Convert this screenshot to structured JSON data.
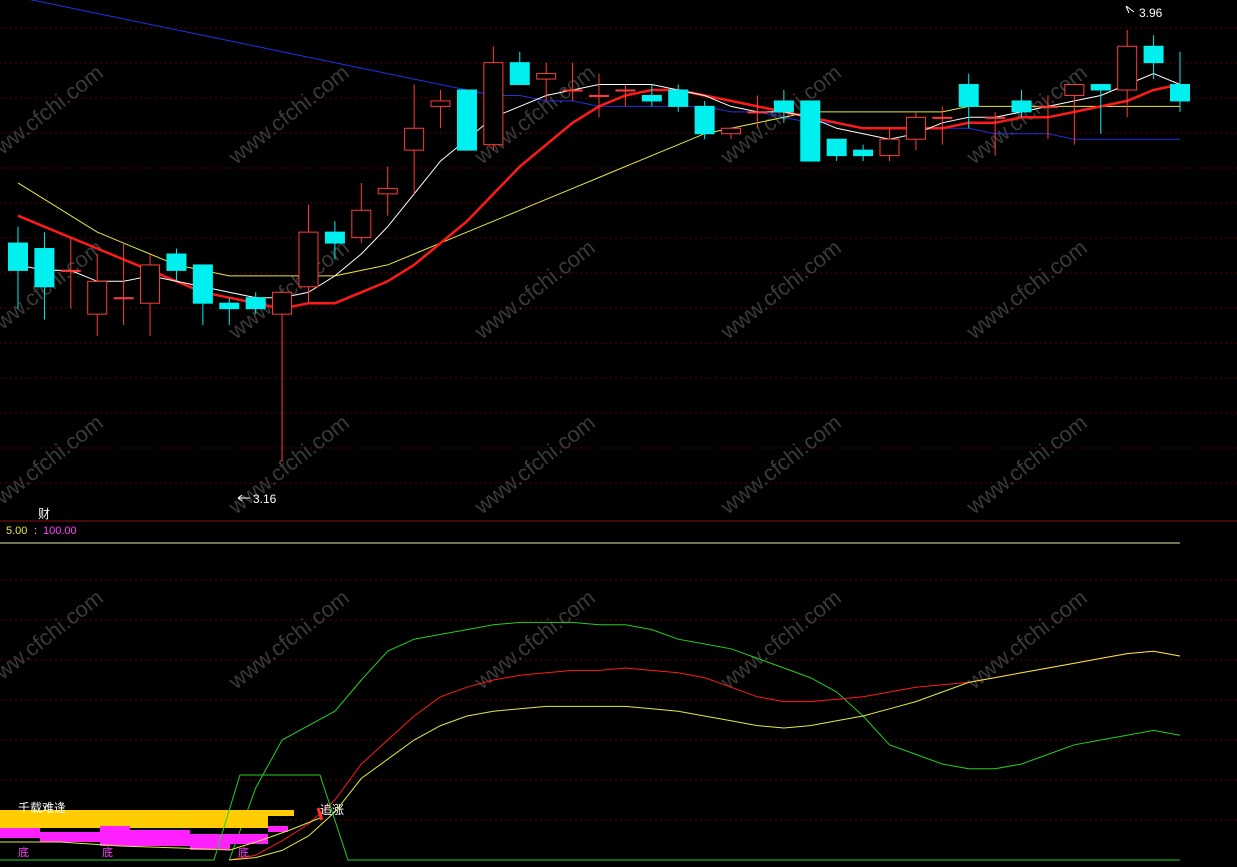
{
  "main_panel": {
    "high_label": "3.96",
    "low_label": "3.16",
    "bottom_tag": "财"
  },
  "indicator_panel": {
    "param_first": "5.00",
    "param_sep": ":",
    "param_second": "100.00",
    "text_left": "千载难逢",
    "text_mid": "追涨",
    "marker_1": "底",
    "marker_2": "底",
    "marker_3": "底"
  },
  "watermark": "www.cfchi.com",
  "colors": {
    "up": "#ff3b3b",
    "down": "#00f0f0",
    "ma_white": "#ffffff",
    "ma_red": "#ff1a1a",
    "ma_yellow": "#e8e840",
    "ma_blue": "#2030e0",
    "grid": "#5a0000",
    "green": "#20d020",
    "magenta": "#ff20ff",
    "gold": "#ffcc00"
  },
  "chart_data": [
    {
      "type": "candlestick",
      "y_range": [
        3.1,
        4.0
      ],
      "candles": [
        {
          "o": 3.57,
          "h": 3.6,
          "l": 3.45,
          "c": 3.52
        },
        {
          "o": 3.56,
          "h": 3.59,
          "l": 3.43,
          "c": 3.49
        },
        {
          "o": 3.52,
          "h": 3.58,
          "l": 3.45,
          "c": 3.52
        },
        {
          "o": 3.44,
          "h": 3.55,
          "l": 3.4,
          "c": 3.5
        },
        {
          "o": 3.47,
          "h": 3.57,
          "l": 3.42,
          "c": 3.47
        },
        {
          "o": 3.46,
          "h": 3.55,
          "l": 3.4,
          "c": 3.53
        },
        {
          "o": 3.55,
          "h": 3.56,
          "l": 3.5,
          "c": 3.52
        },
        {
          "o": 3.53,
          "h": 3.53,
          "l": 3.42,
          "c": 3.46
        },
        {
          "o": 3.46,
          "h": 3.47,
          "l": 3.42,
          "c": 3.45
        },
        {
          "o": 3.47,
          "h": 3.48,
          "l": 3.44,
          "c": 3.45
        },
        {
          "o": 3.44,
          "h": 3.46,
          "l": 3.17,
          "c": 3.48
        },
        {
          "o": 3.49,
          "h": 3.64,
          "l": 3.46,
          "c": 3.59
        },
        {
          "o": 3.59,
          "h": 3.61,
          "l": 3.54,
          "c": 3.57
        },
        {
          "o": 3.58,
          "h": 3.68,
          "l": 3.57,
          "c": 3.63
        },
        {
          "o": 3.66,
          "h": 3.71,
          "l": 3.62,
          "c": 3.67
        },
        {
          "o": 3.74,
          "h": 3.86,
          "l": 3.66,
          "c": 3.78
        },
        {
          "o": 3.82,
          "h": 3.85,
          "l": 3.78,
          "c": 3.83
        },
        {
          "o": 3.85,
          "h": 3.85,
          "l": 3.74,
          "c": 3.74
        },
        {
          "o": 3.75,
          "h": 3.93,
          "l": 3.74,
          "c": 3.9
        },
        {
          "o": 3.9,
          "h": 3.92,
          "l": 3.86,
          "c": 3.86
        },
        {
          "o": 3.87,
          "h": 3.9,
          "l": 3.83,
          "c": 3.88
        },
        {
          "o": 3.85,
          "h": 3.9,
          "l": 3.83,
          "c": 3.85
        },
        {
          "o": 3.84,
          "h": 3.88,
          "l": 3.8,
          "c": 3.84
        },
        {
          "o": 3.85,
          "h": 3.86,
          "l": 3.82,
          "c": 3.85
        },
        {
          "o": 3.84,
          "h": 3.86,
          "l": 3.82,
          "c": 3.83
        },
        {
          "o": 3.85,
          "h": 3.86,
          "l": 3.81,
          "c": 3.82
        },
        {
          "o": 3.82,
          "h": 3.83,
          "l": 3.76,
          "c": 3.77
        },
        {
          "o": 3.77,
          "h": 3.78,
          "l": 3.76,
          "c": 3.78
        },
        {
          "o": 3.81,
          "h": 3.84,
          "l": 3.78,
          "c": 3.81
        },
        {
          "o": 3.83,
          "h": 3.85,
          "l": 3.79,
          "c": 3.81
        },
        {
          "o": 3.83,
          "h": 3.83,
          "l": 3.76,
          "c": 3.72
        },
        {
          "o": 3.76,
          "h": 3.76,
          "l": 3.72,
          "c": 3.73
        },
        {
          "o": 3.74,
          "h": 3.75,
          "l": 3.72,
          "c": 3.73
        },
        {
          "o": 3.73,
          "h": 3.78,
          "l": 3.72,
          "c": 3.76
        },
        {
          "o": 3.76,
          "h": 3.81,
          "l": 3.74,
          "c": 3.8
        },
        {
          "o": 3.8,
          "h": 3.82,
          "l": 3.75,
          "c": 3.8
        },
        {
          "o": 3.86,
          "h": 3.88,
          "l": 3.78,
          "c": 3.82
        },
        {
          "o": 3.8,
          "h": 3.81,
          "l": 3.73,
          "c": 3.8
        },
        {
          "o": 3.83,
          "h": 3.85,
          "l": 3.8,
          "c": 3.81
        },
        {
          "o": 3.82,
          "h": 3.84,
          "l": 3.76,
          "c": 3.82
        },
        {
          "o": 3.84,
          "h": 3.86,
          "l": 3.75,
          "c": 3.86
        },
        {
          "o": 3.86,
          "h": 3.86,
          "l": 3.77,
          "c": 3.85
        },
        {
          "o": 3.85,
          "h": 3.96,
          "l": 3.8,
          "c": 3.93
        },
        {
          "o": 3.93,
          "h": 3.95,
          "l": 3.87,
          "c": 3.9
        },
        {
          "o": 3.86,
          "h": 3.92,
          "l": 3.81,
          "c": 3.83
        }
      ],
      "ma_white": [
        3.53,
        3.52,
        3.52,
        3.5,
        3.5,
        3.51,
        3.5,
        3.49,
        3.48,
        3.47,
        3.47,
        3.48,
        3.51,
        3.55,
        3.6,
        3.66,
        3.72,
        3.76,
        3.8,
        3.82,
        3.84,
        3.85,
        3.86,
        3.86,
        3.86,
        3.85,
        3.84,
        3.82,
        3.81,
        3.81,
        3.8,
        3.78,
        3.77,
        3.76,
        3.77,
        3.79,
        3.8,
        3.8,
        3.81,
        3.82,
        3.83,
        3.84,
        3.86,
        3.88,
        3.86
      ],
      "ma_red": [
        3.62,
        3.6,
        3.58,
        3.56,
        3.54,
        3.52,
        3.5,
        3.48,
        3.47,
        3.46,
        3.45,
        3.46,
        3.46,
        3.48,
        3.5,
        3.53,
        3.57,
        3.61,
        3.66,
        3.71,
        3.75,
        3.79,
        3.82,
        3.84,
        3.85,
        3.85,
        3.84,
        3.83,
        3.82,
        3.81,
        3.8,
        3.79,
        3.78,
        3.78,
        3.78,
        3.78,
        3.79,
        3.79,
        3.8,
        3.8,
        3.81,
        3.82,
        3.83,
        3.85,
        3.86
      ],
      "ma_yellow": [
        3.68,
        3.65,
        3.62,
        3.59,
        3.57,
        3.55,
        3.53,
        3.52,
        3.51,
        3.51,
        3.51,
        3.51,
        3.51,
        3.52,
        3.53,
        3.55,
        3.57,
        3.59,
        3.61,
        3.63,
        3.65,
        3.67,
        3.69,
        3.71,
        3.73,
        3.75,
        3.77,
        3.78,
        3.79,
        3.8,
        3.81,
        3.81,
        3.81,
        3.81,
        3.81,
        3.81,
        3.82,
        3.82,
        3.82,
        3.82,
        3.82,
        3.82,
        3.82,
        3.82,
        3.82
      ],
      "ma_blue": [
        4.02,
        4.01,
        4.0,
        3.99,
        3.98,
        3.97,
        3.96,
        3.95,
        3.94,
        3.93,
        3.92,
        3.91,
        3.9,
        3.89,
        3.88,
        3.87,
        3.86,
        3.85,
        3.84,
        3.84,
        3.83,
        3.83,
        3.82,
        3.82,
        3.82,
        3.82,
        3.82,
        3.81,
        3.81,
        3.8,
        3.79,
        3.79,
        3.78,
        3.78,
        3.78,
        3.78,
        3.78,
        3.77,
        3.77,
        3.77,
        3.76,
        3.76,
        3.76,
        3.76,
        3.76
      ]
    },
    {
      "type": "line",
      "y_range": [
        0,
        100
      ],
      "series": [
        {
          "values": [
            0,
            0,
            0,
            0,
            0,
            0,
            0,
            0,
            0,
            30,
            50,
            56,
            62,
            75,
            87,
            92,
            94,
            96,
            98,
            99,
            99,
            99,
            98,
            98,
            96,
            92,
            90,
            88,
            84,
            80,
            76,
            70,
            60,
            48,
            44,
            40,
            38,
            38,
            40,
            44,
            48,
            50,
            52,
            54,
            52
          ]
        },
        {
          "values": [
            0,
            0,
            0,
            0,
            0,
            0,
            0,
            0,
            0,
            2,
            8,
            15,
            25,
            40,
            50,
            60,
            68,
            72,
            75,
            77,
            78,
            79,
            79,
            80,
            79,
            78,
            76,
            72,
            68,
            66,
            66,
            67,
            68,
            70,
            72,
            73,
            74,
            76,
            78,
            80,
            82,
            84,
            86,
            87,
            85
          ]
        },
        {
          "values": [
            0,
            0,
            0,
            0,
            0,
            0,
            0,
            0,
            0,
            1,
            4,
            10,
            20,
            34,
            42,
            50,
            56,
            60,
            62,
            63,
            64,
            64,
            64,
            64,
            63,
            62,
            60,
            58,
            56,
            55,
            56,
            58,
            60,
            63,
            66,
            70,
            74,
            76,
            78,
            80,
            82,
            84,
            86,
            87,
            85
          ]
        }
      ]
    }
  ]
}
